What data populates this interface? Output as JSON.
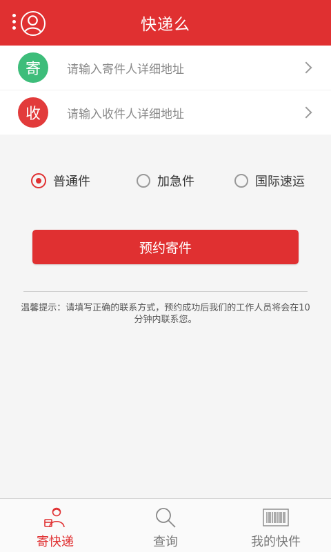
{
  "header": {
    "title": "快递么",
    "menu_icon": "more-vertical-icon",
    "avatar_icon": "user-avatar-icon"
  },
  "sender": {
    "badge": "寄",
    "placeholder": "请输入寄件人详细地址",
    "badge_color": "#3dbd7a"
  },
  "receiver": {
    "badge": "收",
    "placeholder": "请输入收件人详细地址",
    "badge_color": "#e23b3b"
  },
  "shipping_types": {
    "selected": "普通件",
    "options": [
      {
        "label": "普通件",
        "selected": true
      },
      {
        "label": "加急件",
        "selected": false
      },
      {
        "label": "国际速运",
        "selected": false
      }
    ]
  },
  "submit_label": "预约寄件",
  "tip": "温馨提示：请填写正确的联系方式，预约成功后我们的工作人员将会在10分钟内联系您。",
  "tabs": [
    {
      "label": "寄快递",
      "icon": "courier-icon",
      "active": true
    },
    {
      "label": "查询",
      "icon": "search-icon",
      "active": false
    },
    {
      "label": "我的快件",
      "icon": "barcode-icon",
      "active": false
    }
  ],
  "colors": {
    "accent": "#e03031",
    "placeholder_text": "#8a8a8a"
  }
}
